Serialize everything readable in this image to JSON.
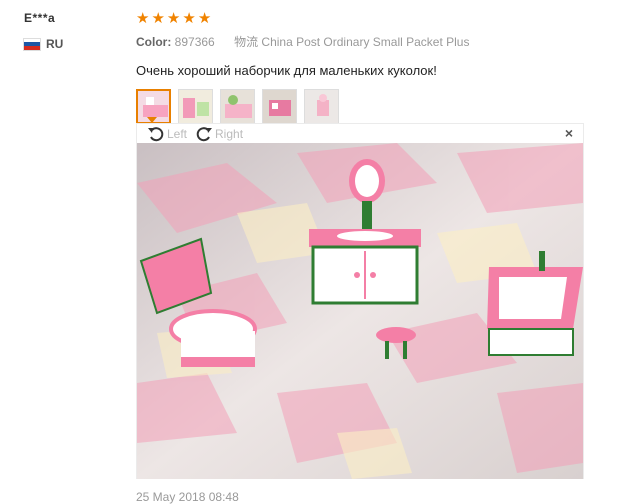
{
  "reviewer": {
    "name": "E***a",
    "country": "RU"
  },
  "review": {
    "stars": [
      "★",
      "★",
      "★",
      "★",
      "★"
    ],
    "color_label": "Color:",
    "color_value": "897366",
    "shipping": "物流 China Post Ordinary Small Packet Plus",
    "text": "Очень хороший наборчик для маленьких куколок!",
    "date": "25 May 2018 08:48"
  },
  "viewer": {
    "rotate_left": "Left",
    "rotate_right": "Right",
    "close": "×"
  },
  "thumbnails": [
    "bathroom-set-1",
    "furniture-set-2",
    "bedroom-set-3",
    "kitchen-set-4",
    "bathroom-set-5"
  ]
}
